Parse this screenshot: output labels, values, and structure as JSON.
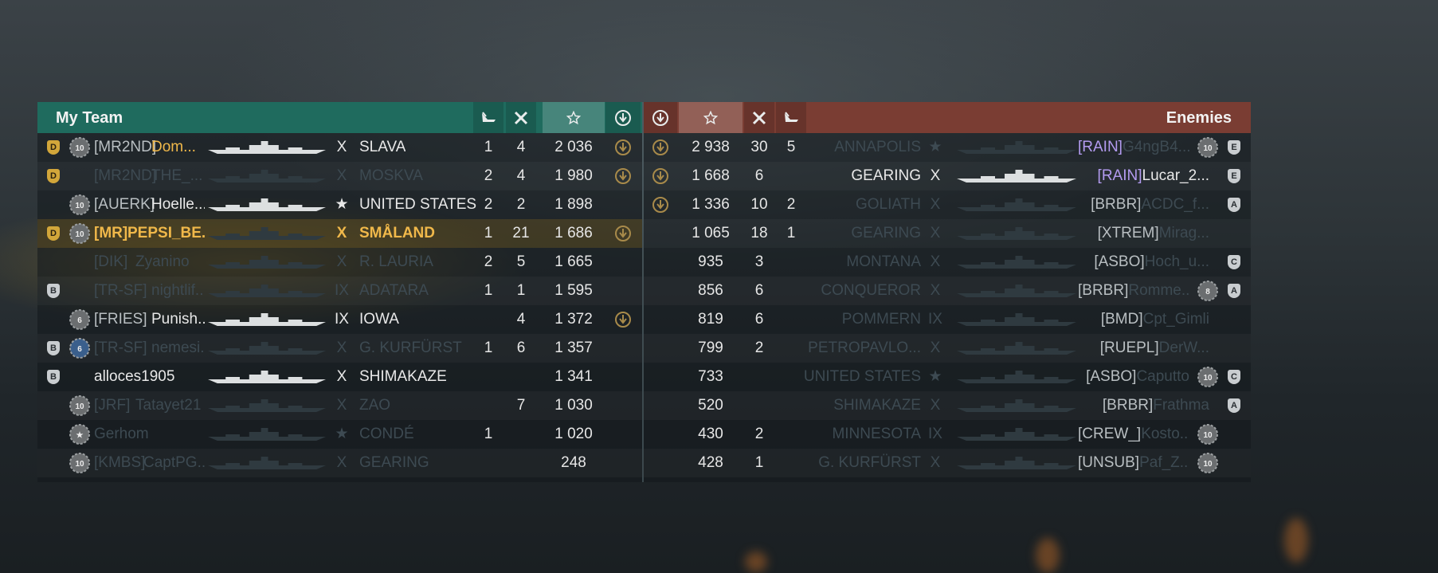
{
  "left_header": {
    "title": "My Team"
  },
  "right_header": {
    "title": "Enemies"
  },
  "colors": {
    "ally": "#1f6b5e",
    "enemy": "#7a3d33",
    "gold": "#f0b84a",
    "purple": "#b39bf0"
  },
  "left_rows": [
    {
      "badge": "D",
      "rank": "10",
      "clan": "[MR2ND]",
      "name": "Dom...",
      "tier": "X",
      "ship": "SLAVA",
      "kills": "1",
      "planes": "4",
      "score": "2 036",
      "honor": true,
      "lit": true,
      "name_gold": true
    },
    {
      "badge": "D",
      "rank": "",
      "clan": "[MR2ND]",
      "name": "THE_...",
      "tier": "X",
      "ship": "MOSKVA",
      "kills": "2",
      "planes": "4",
      "score": "1 980",
      "honor": true,
      "lit": false
    },
    {
      "badge": "",
      "rank": "10",
      "clan": "[AUERK]",
      "name": "Hoelle...",
      "tier": "★",
      "ship": "UNITED STATES",
      "kills": "2",
      "planes": "2",
      "score": "1 898",
      "honor": false,
      "lit": true
    },
    {
      "badge": "D",
      "rank": "10",
      "clan": "[MR]",
      "name": "PEPSI_BE...",
      "tier": "X",
      "ship": "SMÅLAND",
      "kills": "1",
      "planes": "21",
      "score": "1 686",
      "honor": true,
      "lit": true,
      "me": true
    },
    {
      "badge": "",
      "rank": "",
      "clan": "[DIK]",
      "name": "Zyanino",
      "tier": "X",
      "ship": "R. LAURIA",
      "kills": "2",
      "planes": "5",
      "score": "1 665",
      "honor": false,
      "lit": false
    },
    {
      "badge": "B",
      "rank": "",
      "clan": "[TR-SF]",
      "name": "nightlif...",
      "tier": "IX",
      "ship": "ADATARA",
      "kills": "1",
      "planes": "1",
      "score": "1 595",
      "honor": false,
      "lit": false
    },
    {
      "badge": "",
      "rank": "6",
      "clan": "[FRIES]",
      "name": "Punish...",
      "tier": "IX",
      "ship": "IOWA",
      "kills": "",
      "planes": "4",
      "score": "1 372",
      "honor": true,
      "lit": true
    },
    {
      "badge": "B",
      "rank": "6",
      "clan": "[TR-SF]",
      "name": "nemesi...",
      "tier": "X",
      "ship": "G. KURFÜRST",
      "kills": "1",
      "planes": "6",
      "score": "1 357",
      "honor": false,
      "lit": false,
      "rank_blue": true
    },
    {
      "badge": "B",
      "rank": "",
      "clan": "",
      "name": "alloces1905",
      "tier": "X",
      "ship": "SHIMAKAZE",
      "kills": "",
      "planes": "",
      "score": "1 341",
      "honor": false,
      "lit": true
    },
    {
      "badge": "",
      "rank": "10",
      "clan": "[JRF]",
      "name": "Tatayet21",
      "tier": "X",
      "ship": "ZAO",
      "kills": "",
      "planes": "7",
      "score": "1 030",
      "honor": false,
      "lit": false
    },
    {
      "badge": "",
      "rank": "★",
      "clan": "",
      "name": "Gerhom",
      "tier": "★",
      "ship": "CONDÉ",
      "kills": "1",
      "planes": "",
      "score": "1 020",
      "honor": false,
      "lit": false
    },
    {
      "badge": "",
      "rank": "10",
      "clan": "[KMBS]",
      "name": "CaptPG...",
      "tier": "X",
      "ship": "GEARING",
      "kills": "",
      "planes": "",
      "score": "248",
      "honor": false,
      "lit": false
    }
  ],
  "right_rows": [
    {
      "honor": true,
      "score": "2 938",
      "planes": "30",
      "kills": "5",
      "ship": "ANNAPOLIS",
      "tier": "★",
      "clan": "[RAIN]",
      "name": "G4ngB4...",
      "rank": "10",
      "badge": "E",
      "lit": false,
      "purple": true
    },
    {
      "honor": true,
      "score": "1 668",
      "planes": "6",
      "kills": "",
      "ship": "GEARING",
      "tier": "X",
      "clan": "[RAIN]",
      "name": "Lucar_2...",
      "rank": "",
      "badge": "E",
      "lit": true,
      "purple": true
    },
    {
      "honor": true,
      "score": "1 336",
      "planes": "10",
      "kills": "2",
      "ship": "GOLIATH",
      "tier": "X",
      "clan": "[BRBR]",
      "name": "ACDC_f...",
      "rank": "",
      "badge": "A",
      "lit": false
    },
    {
      "honor": false,
      "score": "1 065",
      "planes": "18",
      "kills": "1",
      "ship": "GEARING",
      "tier": "X",
      "clan": "[XTREM]",
      "name": "Mirag...",
      "rank": "",
      "badge": "",
      "lit": false
    },
    {
      "honor": false,
      "score": "935",
      "planes": "3",
      "kills": "",
      "ship": "MONTANA",
      "tier": "X",
      "clan": "[ASBO]",
      "name": "Hoch_u...",
      "rank": "",
      "badge": "C",
      "lit": false
    },
    {
      "honor": false,
      "score": "856",
      "planes": "6",
      "kills": "",
      "ship": "CONQUEROR",
      "tier": "X",
      "clan": "[BRBR]",
      "name": "Romme...",
      "rank": "8",
      "badge": "A",
      "lit": false
    },
    {
      "honor": false,
      "score": "819",
      "planes": "6",
      "kills": "",
      "ship": "POMMERN",
      "tier": "IX",
      "clan": "[BMD]",
      "name": "Cpt_Gimli",
      "rank": "",
      "badge": "",
      "lit": false
    },
    {
      "honor": false,
      "score": "799",
      "planes": "2",
      "kills": "",
      "ship": "PETROPAVLO...",
      "tier": "X",
      "clan": "[RUEPL]",
      "name": "DerW...",
      "rank": "",
      "badge": "",
      "lit": false
    },
    {
      "honor": false,
      "score": "733",
      "planes": "",
      "kills": "",
      "ship": "UNITED STATES",
      "tier": "★",
      "clan": "[ASBO]",
      "name": "Caputto",
      "rank": "10",
      "badge": "C",
      "lit": false
    },
    {
      "honor": false,
      "score": "520",
      "planes": "",
      "kills": "",
      "ship": "SHIMAKAZE",
      "tier": "X",
      "clan": "[BRBR]",
      "name": "Frathma",
      "rank": "",
      "badge": "A",
      "lit": false
    },
    {
      "honor": false,
      "score": "430",
      "planes": "2",
      "kills": "",
      "ship": "MINNESOTA",
      "tier": "IX",
      "clan": "[CREW_]",
      "name": "Kosto...",
      "rank": "10",
      "badge": "",
      "lit": false
    },
    {
      "honor": false,
      "score": "428",
      "planes": "1",
      "kills": "",
      "ship": "G. KURFÜRST",
      "tier": "X",
      "clan": "[UNSUB]",
      "name": "Paf_Z...",
      "rank": "10",
      "badge": "",
      "lit": false
    }
  ]
}
